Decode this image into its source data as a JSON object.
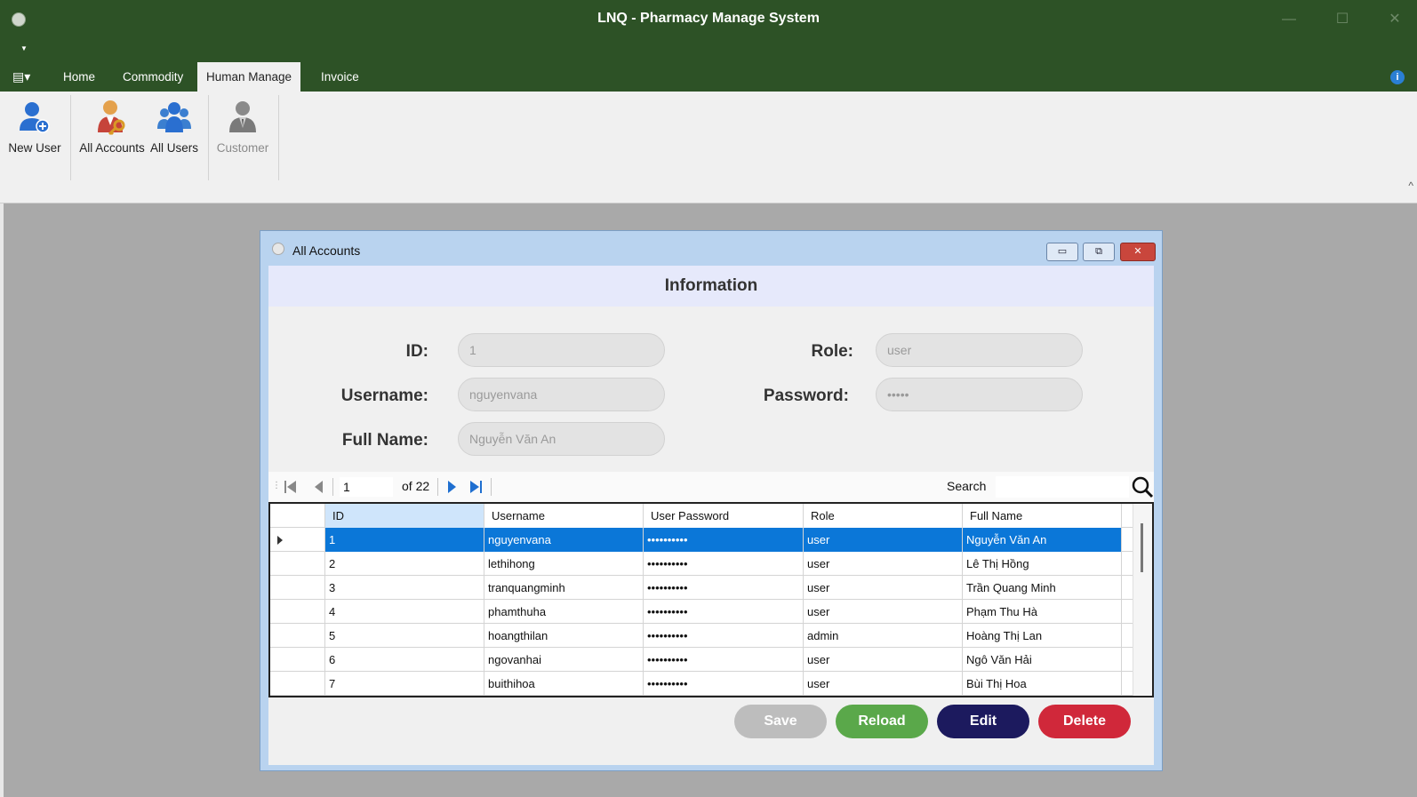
{
  "app": {
    "title": "LNQ - Pharmacy Manage System"
  },
  "window_controls": {
    "minimize": "—",
    "maximize": "☐",
    "close": "✕"
  },
  "ribbon": {
    "tabs": [
      {
        "label": "Home"
      },
      {
        "label": "Commodity"
      },
      {
        "label": "Human Manage"
      },
      {
        "label": "Invoice"
      }
    ],
    "active_tab": "Human Manage",
    "buttons": [
      {
        "label": "New User",
        "icon": "user-add-icon"
      },
      {
        "label": "All Accounts",
        "icon": "accounts-key-icon"
      },
      {
        "label": "All Users",
        "icon": "users-group-icon"
      },
      {
        "label": "Customer",
        "icon": "customer-icon"
      }
    ],
    "info": "i"
  },
  "child_window": {
    "title": "All Accounts",
    "header": "Information",
    "labels": {
      "id": "ID:",
      "username": "Username:",
      "fullname": "Full Name:",
      "role": "Role:",
      "password": "Password:"
    },
    "fields": {
      "id": "1",
      "username": "nguyenvana",
      "fullname": "Nguyễn Văn An",
      "role": "user",
      "password": "•••••"
    },
    "navigator": {
      "position": "1",
      "of": "of 22",
      "search_label": "Search"
    },
    "grid": {
      "columns": [
        "ID",
        "Username",
        "User Password",
        "Role",
        "Full Name"
      ],
      "rows": [
        [
          "1",
          "nguyenvana",
          "••••••••••",
          "user",
          "Nguyễn Văn An"
        ],
        [
          "2",
          "lethihong",
          "••••••••••",
          "user",
          "Lê Thị Hồng"
        ],
        [
          "3",
          "tranquangminh",
          "••••••••••",
          "user",
          "Trần Quang Minh"
        ],
        [
          "4",
          "phamthuha",
          "••••••••••",
          "user",
          "Phạm Thu Hà"
        ],
        [
          "5",
          "hoangthilan",
          "••••••••••",
          "admin",
          "Hoàng Thị Lan"
        ],
        [
          "6",
          "ngovanhai",
          "••••••••••",
          "user",
          "Ngô Văn Hải"
        ],
        [
          "7",
          "buithihoa",
          "••••••••••",
          "user",
          "Bùi Thị Hoa"
        ]
      ]
    },
    "actions": {
      "save": "Save",
      "reload": "Reload",
      "edit": "Edit",
      "delete": "Delete"
    },
    "colors": {
      "save": "#bdbdbd",
      "reload": "#5aa84a",
      "edit": "#1c1a5e",
      "delete": "#d0283a"
    }
  }
}
